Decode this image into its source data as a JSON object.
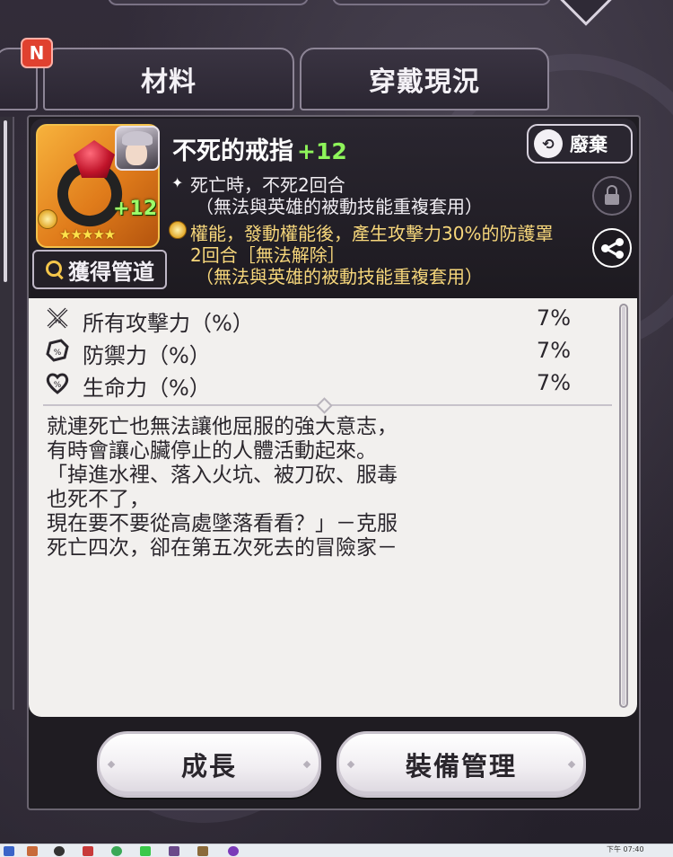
{
  "tabs": [
    {
      "label": "材料"
    },
    {
      "label": "穿戴現況"
    }
  ],
  "new_badge": "N",
  "item": {
    "name": "不死的戒指",
    "enhance": "+12",
    "icon_level": "+12",
    "stars": "★★★★★",
    "acquire_label": "獲得管道",
    "discard_label": "廢棄",
    "effects": [
      {
        "text": "死亡時，不死2回合"
      },
      {
        "text": "（無法與英雄的被動技能重複套用）"
      },
      {
        "text": "權能，發動權能後，產生攻擊力30%的防護罩"
      },
      {
        "text": "2回合［無法解除］"
      },
      {
        "text": "（無法與英雄的被動技能重複套用）"
      }
    ]
  },
  "stats": [
    {
      "icon": "attack-icon",
      "label": "所有攻擊力（%）",
      "value": "7%"
    },
    {
      "icon": "defense-icon",
      "label": "防禦力（%）",
      "value": "7%"
    },
    {
      "icon": "health-icon",
      "label": "生命力（%）",
      "value": "7%"
    }
  ],
  "lore": [
    "就連死亡也無法讓他屈服的強大意志，",
    "有時會讓心臟停止的人體活動起來。",
    "「掉進水裡、落入火坑、被刀砍、服毒",
    "也死不了，",
    "現在要不要從高處墜落看看？」－克服",
    "死亡四次，卻在第五次死去的冒險家－"
  ],
  "buttons": {
    "grow": "成長",
    "manage": "裝備管理"
  },
  "taskbar": {
    "clock": "下午 07:40"
  },
  "colors": {
    "enhance_green": "#8ef55a",
    "gold_text": "#f7d77b",
    "badge_red": "#e0412f"
  }
}
